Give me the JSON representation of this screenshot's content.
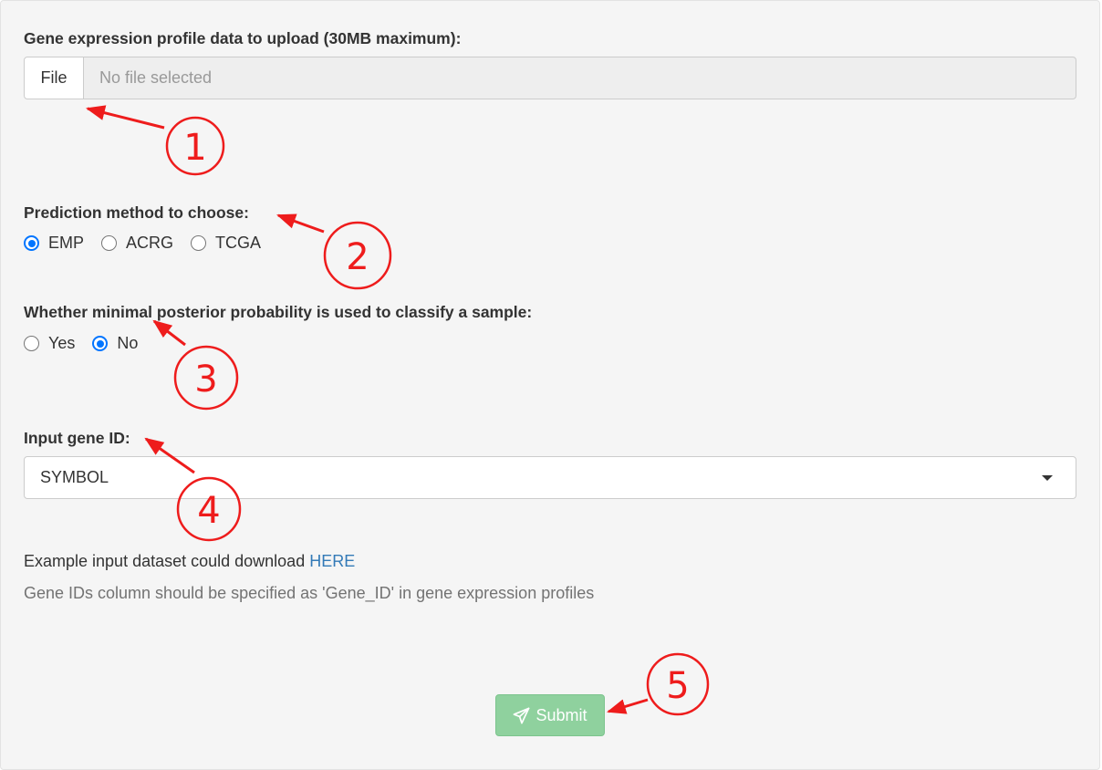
{
  "upload": {
    "label": "Gene expression profile data to upload (30MB maximum):",
    "button_label": "File",
    "placeholder": "No file selected"
  },
  "method": {
    "label": "Prediction method to choose:",
    "options": [
      "EMP",
      "ACRG",
      "TCGA"
    ],
    "selected": "EMP"
  },
  "posterior": {
    "label": "Whether minimal posterior probability is used to classify a sample:",
    "options": [
      "Yes",
      "No"
    ],
    "selected": "No"
  },
  "gene_id": {
    "label": "Input gene ID:",
    "value": "SYMBOL"
  },
  "example": {
    "text": "Example input dataset could download ",
    "link": "HERE"
  },
  "help_text": "Gene IDs column should be specified as 'Gene_ID' in gene expression profiles",
  "submit_label": "Submit",
  "annotations": [
    "1",
    "2",
    "3",
    "4",
    "5"
  ],
  "colors": {
    "panel_bg": "#f5f5f5",
    "radio_accent": "#0075ff",
    "link": "#337ab7",
    "submit_bg": "#8fd19e",
    "annotation": "#ee1c1c"
  }
}
